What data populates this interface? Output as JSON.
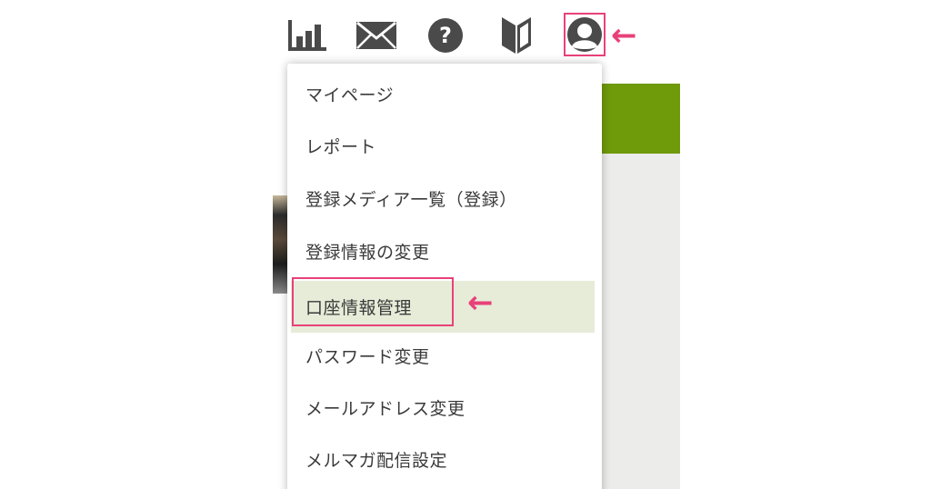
{
  "icons": [
    {
      "name": "report-chart-icon"
    },
    {
      "name": "mail-icon"
    },
    {
      "name": "help-icon"
    },
    {
      "name": "beginner-mark-icon"
    },
    {
      "name": "user-account-icon"
    }
  ],
  "arrows": {
    "top": "←",
    "menu": "←"
  },
  "menu": {
    "items": [
      {
        "label": "マイページ"
      },
      {
        "label": "レポート"
      },
      {
        "label": "登録メディア一覧（登録）"
      },
      {
        "label": "登録情報の変更"
      },
      {
        "label": "口座情報管理"
      },
      {
        "label": "パスワード変更"
      },
      {
        "label": "メールアドレス変更"
      },
      {
        "label": "メルマガ配信設定"
      }
    ],
    "active_index": 4
  },
  "colors": {
    "icon": "#4a4a4a",
    "highlight": "#e8417a",
    "active_bg": "#e6ecd8",
    "brand_green": "#6f9a0a"
  }
}
